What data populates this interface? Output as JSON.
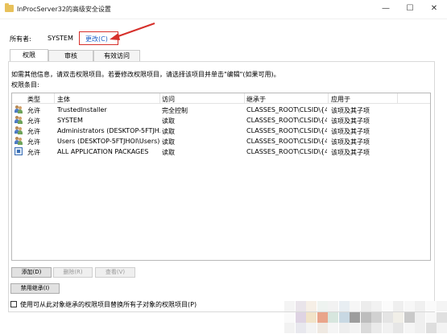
{
  "window": {
    "title": "InProcServer32的高级安全设置",
    "min_glyph": "—",
    "max_glyph": "☐",
    "close_glyph": "✕"
  },
  "owner": {
    "label": "所有者:",
    "value": "SYSTEM",
    "change_link": "更改(C)"
  },
  "tabs": [
    {
      "label": "权限"
    },
    {
      "label": "审核"
    },
    {
      "label": "有效访问"
    }
  ],
  "hint_text": "如需其他信息，请双击权限项目。若要修改权限项目，请选择该项目并单击\"编辑\"(如果可用)。",
  "entries_label": "权限条目:",
  "columns": {
    "type": "类型",
    "principal": "主体",
    "access": "访问",
    "inherited_from": "继承于",
    "applies_to": "应用于"
  },
  "rows": [
    {
      "icon": "users-icon",
      "type": "允许",
      "principal": "TrustedInstaller",
      "access": "完全控制",
      "inherited_from": "CLASSES_ROOT\\CLSID\\{4...",
      "applies_to": "该项及其子项"
    },
    {
      "icon": "users-icon",
      "type": "允许",
      "principal": "SYSTEM",
      "access": "读取",
      "inherited_from": "CLASSES_ROOT\\CLSID\\{4...",
      "applies_to": "该项及其子项"
    },
    {
      "icon": "users-icon",
      "type": "允许",
      "principal": "Administrators (DESKTOP-5FTJH...",
      "access": "读取",
      "inherited_from": "CLASSES_ROOT\\CLSID\\{4...",
      "applies_to": "该项及其子项"
    },
    {
      "icon": "users-icon",
      "type": "允许",
      "principal": "Users (DESKTOP-5FTJHOI\\Users)",
      "access": "读取",
      "inherited_from": "CLASSES_ROOT\\CLSID\\{4...",
      "applies_to": "该项及其子项"
    },
    {
      "icon": "package-icon",
      "type": "允许",
      "principal": "ALL APPLICATION PACKAGES",
      "access": "读取",
      "inherited_from": "CLASSES_ROOT\\CLSID\\{4...",
      "applies_to": "该项及其子项"
    }
  ],
  "buttons": {
    "add": "添加(D)",
    "remove": "删除(R)",
    "view": "查看(V)",
    "disable_inheritance": "禁用继承(I)"
  },
  "replace_checkbox": {
    "label": "使用可从此对象继承的权限项目替换所有子对象的权限项目(P)",
    "checked": false
  },
  "colors": {
    "link": "#1a5fc9",
    "highlight_border": "#d6302b"
  }
}
